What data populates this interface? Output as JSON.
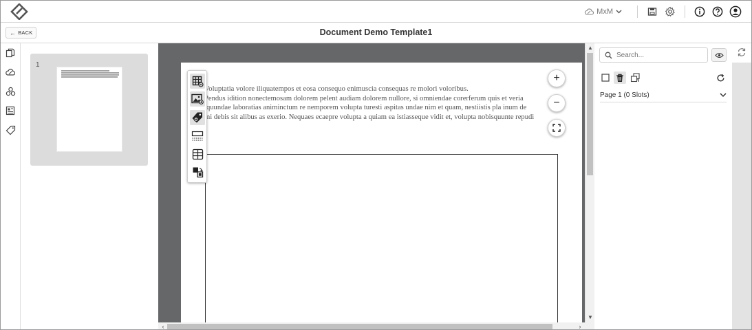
{
  "header": {
    "org_name": "MxM",
    "icons": [
      "cloud-icon",
      "chevron-down-icon",
      "save-icon",
      "gear-icon",
      "info-icon",
      "help-icon",
      "user-icon"
    ]
  },
  "titlebar": {
    "back_label": "BACK",
    "title": "Document Demo Template1"
  },
  "left_rail": {
    "icons": [
      "pages-icon",
      "cloud-edit-icon",
      "components-icon",
      "layout-icon",
      "tag-icon"
    ]
  },
  "thumbnails": [
    {
      "number": "1"
    }
  ],
  "page": {
    "lines": [
      "Voluptatia volore iliquatempos et eosa consequo enimuscia consequas re molori voloribus.",
      "Pendus idition nonectemosam dolorem pelent audiam dolorem nullore, si omniendae corerferum quis et veria",
      "iquundae laboratias animinctum re nemporem volupta turesti aspitas undae nim et quam, nestiistis pla inum de",
      "mi debis sit alibus as exerio. Nequaes ecaepre volupta a quiam ea istiasseque vidit et, volupta nobisquunte repudi"
    ]
  },
  "tools": [
    "table-grid-icon",
    "image-icon",
    "tag-icon",
    "divider-icon",
    "table-icon",
    "swap-icon"
  ],
  "zoom": {
    "in": "+",
    "out": "−"
  },
  "right_panel": {
    "search_placeholder": "Search...",
    "page_row_label": "Page 1 (0 Slots)"
  }
}
